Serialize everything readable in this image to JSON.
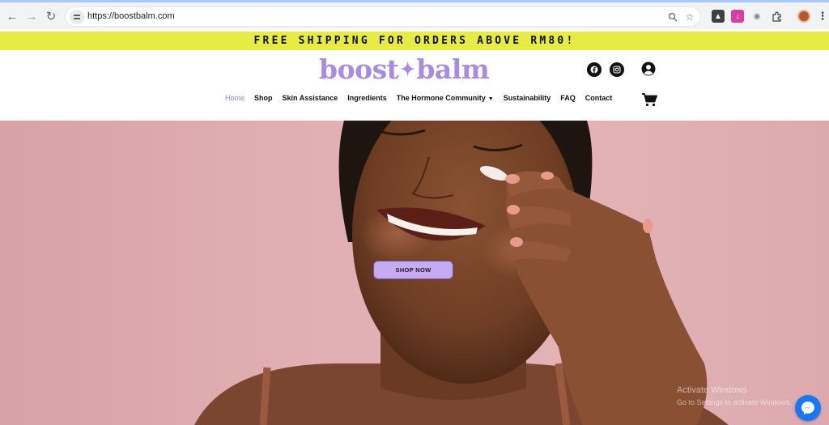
{
  "browser": {
    "url": "https://boostbalm.com",
    "icons": [
      "back-arrow-icon",
      "forward-arrow-icon",
      "reload-icon",
      "site-settings-icon",
      "zoom-icon",
      "bookmark-star-icon",
      "extension-icons",
      "puzzle-icon",
      "profile-avatar",
      "kebab-menu-icon"
    ]
  },
  "announcement": {
    "text": "FREE SHIPPING FOR ORDERS ABOVE RM80!"
  },
  "header": {
    "logo_left": "boost",
    "logo_star": "✦",
    "logo_right": "balm",
    "nav": {
      "home": "Home",
      "shop": "Shop",
      "skin_assistance": "Skin Assistance",
      "ingredients": "Ingredients",
      "hormone_community": "The Hormone Community",
      "sustainability": "Sustainability",
      "faq": "FAQ",
      "contact": "Contact"
    },
    "active_nav": "Home"
  },
  "hero": {
    "cta_label": "SHOP NOW"
  },
  "os": {
    "watermark_line1": "Activate Windows",
    "watermark_line2": "Go to Settings to activate Windows."
  },
  "colors": {
    "brand_purple": "#a98be0",
    "announce_yellow": "#e6ec43",
    "hero_pink": "#e2b0b4",
    "cta_lavender": "#c6aaf2",
    "messenger_blue": "#1877f2"
  }
}
